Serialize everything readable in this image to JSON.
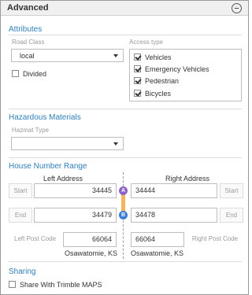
{
  "header": {
    "title": "Advanced"
  },
  "attributes": {
    "title": "Attributes",
    "road_class_label": "Road Class",
    "road_class_value": "local",
    "divided_label": "Divided",
    "access_type_label": "Access type",
    "access_types": [
      {
        "label": "Vehicles",
        "checked": true
      },
      {
        "label": "Emergency Vehicles",
        "checked": true
      },
      {
        "label": "Pedestrian",
        "checked": true
      },
      {
        "label": "Bicycles",
        "checked": true
      }
    ]
  },
  "hazmat": {
    "title": "Hazardous Materials",
    "type_label": "Hazmat Type",
    "type_value": ""
  },
  "house_numbers": {
    "title": "House Number Range",
    "left_header": "Left Address",
    "right_header": "Right Address",
    "start_label": "Start",
    "end_label": "End",
    "left_start": "34445",
    "left_end": "34479",
    "right_start": "34444",
    "right_end": "34478",
    "marker_a": "A",
    "marker_b": "B",
    "left_post_code_label": "Left Post Code",
    "right_post_code_label": "Right Post Code",
    "left_post_code": "66064",
    "right_post_code": "66064",
    "left_city": "Osawatomie, KS",
    "right_city": "Osawatomie, KS"
  },
  "sharing": {
    "title": "Sharing",
    "share_label": "Share With Trimble MAPS"
  },
  "colors": {
    "section_title": "#2f7fb8",
    "marker": "#8e63c9",
    "connector": "#f5b35a"
  }
}
